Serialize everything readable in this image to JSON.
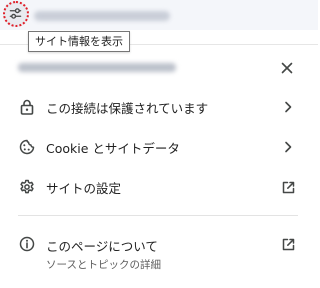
{
  "tooltip": {
    "text": "サイト情報を表示"
  },
  "rows": {
    "connection": {
      "label": "この接続は保護されています",
      "icon": "lock-icon",
      "trailing_icon": "chevron-right-icon"
    },
    "cookie": {
      "label": "Cookie とサイトデータ",
      "icon": "cookie-icon",
      "trailing_icon": "chevron-right-icon"
    },
    "settings": {
      "label": "サイトの設定",
      "icon": "gear-icon",
      "trailing_icon": "open-external-icon"
    },
    "about": {
      "label": "このページについて",
      "sublabel": "ソースとトピックの詳細",
      "icon": "info-icon",
      "trailing_icon": "open-external-icon"
    }
  },
  "colors": {
    "highlight_circle": "#e0202a",
    "text_primary": "#1f1f1f",
    "text_secondary": "#5e5e5e",
    "icon": "#444746"
  }
}
